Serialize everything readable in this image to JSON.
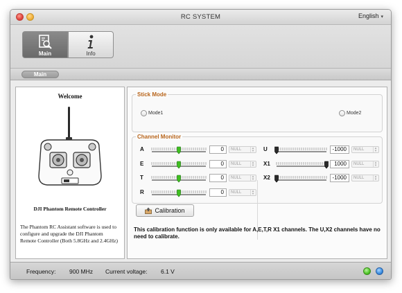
{
  "window": {
    "title": "RC SYSTEM",
    "language": "English"
  },
  "toolbar": {
    "main_label": "Main",
    "info_label": "Info",
    "icons": {
      "main": "document-search-icon",
      "info": "info-icon"
    }
  },
  "breadcrumb": {
    "label": "Main"
  },
  "left_panel": {
    "welcome": "Welcome",
    "device_name": "DJI Phantom Remote Controller",
    "description": "The Phantom RC Assistant software is used to configure and upgrade the DJI Phantom Remote Controller (Both 5.8GHz and 2.4GHz)"
  },
  "stick_mode": {
    "title": "Stick Mode",
    "mode1": "Mode1",
    "mode2": "Mode2"
  },
  "channel_monitor": {
    "title": "Channel Monitor",
    "left_channels": [
      {
        "name": "A",
        "value": "0",
        "option": "NULL",
        "level": 0.5
      },
      {
        "name": "E",
        "value": "0",
        "option": "NULL",
        "level": 0.5
      },
      {
        "name": "T",
        "value": "0",
        "option": "NULL",
        "level": 0.5
      },
      {
        "name": "R",
        "value": "0",
        "option": "NULL",
        "level": 0.5
      }
    ],
    "right_channels": [
      {
        "name": "U",
        "value": "-1000",
        "option": "NULL",
        "level": 0.0
      },
      {
        "name": "X1",
        "value": "1000",
        "option": "NULL",
        "level": 1.0
      },
      {
        "name": "X2",
        "value": "-1000",
        "option": "NULL",
        "level": 0.0
      }
    ]
  },
  "calibration": {
    "button_label": "Calibration",
    "note": "This calibration function is only available for A,E,T,R X1 channels. The U,X2 channels have no need to calibrate."
  },
  "status": {
    "frequency_label": "Frequency:",
    "frequency_value": "900 MHz",
    "voltage_label": "Current voltage:",
    "voltage_value": "6.1 V"
  },
  "colors": {
    "accent_orange": "#b8651b",
    "slider_green": "#3fbf20",
    "led_green": "#4fc526",
    "led_blue": "#3a8ce0"
  }
}
